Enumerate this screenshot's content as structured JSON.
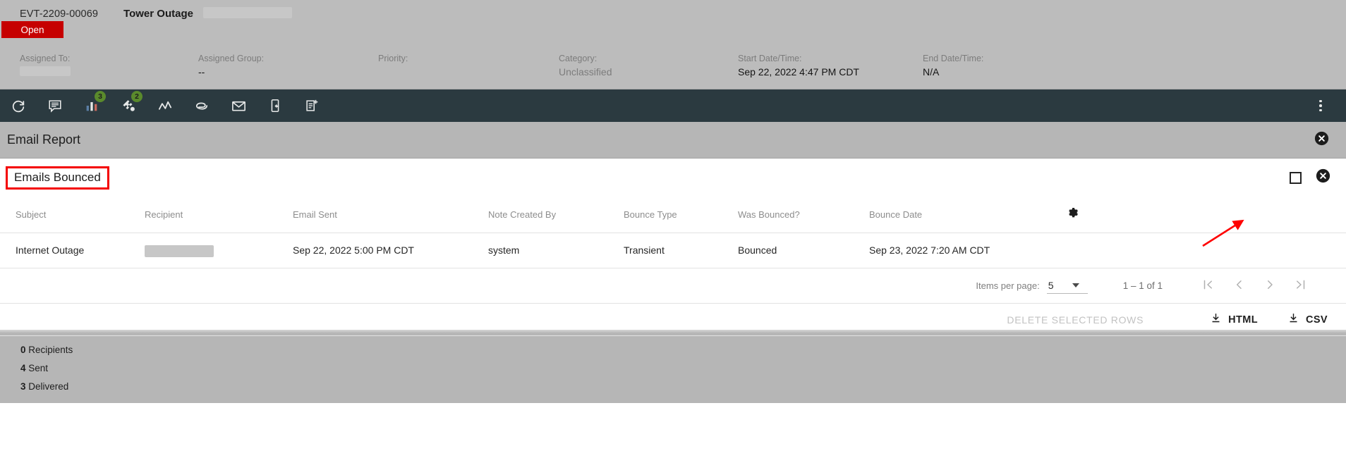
{
  "record": {
    "id": "EVT-2209-00069",
    "title": "Tower Outage",
    "status": "Open",
    "fields": [
      {
        "label": "Assigned To:",
        "value": "",
        "redacted": true
      },
      {
        "label": "Assigned Group:",
        "value": "--",
        "redacted": false
      },
      {
        "label": "Priority:",
        "value": "",
        "redacted": false
      },
      {
        "label": "Category:",
        "value": "Unclassified",
        "redacted": false
      },
      {
        "label": "Start Date/Time:",
        "value": "Sep 22, 2022 4:47 PM CDT",
        "redacted": false
      },
      {
        "label": "End Date/Time:",
        "value": "N/A",
        "redacted": false
      }
    ]
  },
  "toolbar": {
    "items": [
      {
        "icon": "refresh-icon",
        "badge": ""
      },
      {
        "icon": "notes-icon",
        "badge": ""
      },
      {
        "icon": "bar-chart-icon",
        "badge": "3"
      },
      {
        "icon": "puzzle-icon",
        "badge": "2"
      },
      {
        "icon": "trend-line-icon",
        "badge": ""
      },
      {
        "icon": "paperclip-icon",
        "badge": ""
      },
      {
        "icon": "envelope-icon",
        "badge": ""
      },
      {
        "icon": "mobile-reply-icon",
        "badge": ""
      },
      {
        "icon": "new-note-icon",
        "badge": ""
      }
    ],
    "overflow_icon": "more-vertical-icon"
  },
  "panel": {
    "title": "Email Report",
    "close_icon": "close-circle-icon"
  },
  "report": {
    "section_title": "Emails Bounced",
    "select_all_icon": "checkbox-icon",
    "close_icon": "close-circle-icon",
    "settings_icon": "gear-icon",
    "columns": [
      "Subject",
      "Recipient",
      "Email Sent",
      "Note Created By",
      "Bounce Type",
      "Was Bounced?",
      "Bounce Date"
    ],
    "rows": [
      {
        "subject": "Internet Outage",
        "recipient": "",
        "recipient_redacted": true,
        "email_sent": "Sep 22, 2022 5:00 PM CDT",
        "note_created_by": "system",
        "bounce_type": "Transient",
        "was_bounced": "Bounced",
        "bounce_date": "Sep 23, 2022 7:20 AM CDT"
      }
    ]
  },
  "paginator": {
    "items_per_page_label": "Items per page:",
    "items_per_page_value": "5",
    "range_label": "1 – 1 of 1",
    "first_icon": "first-page-icon",
    "prev_icon": "previous-page-icon",
    "next_icon": "next-page-icon",
    "last_icon": "last-page-icon"
  },
  "export": {
    "delete_label": "DELETE SELECTED ROWS",
    "html_label": "HTML",
    "csv_label": "CSV",
    "download_icon": "download-icon"
  },
  "annotation": {
    "arrow_color": "#ff0000"
  },
  "summary": {
    "lines": [
      {
        "count": "0",
        "label": "Recipients"
      },
      {
        "count": "4",
        "label": "Sent"
      },
      {
        "count": "3",
        "label": "Delivered"
      }
    ]
  }
}
